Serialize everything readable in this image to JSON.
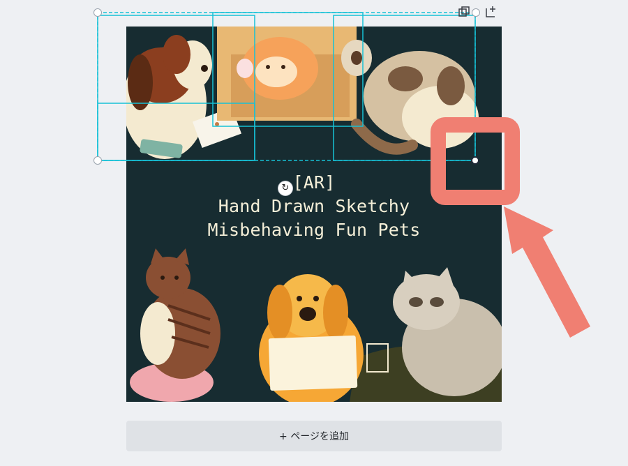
{
  "design": {
    "title_line1": "[AR]",
    "title_line2": "Hand Drawn Sketchy",
    "title_line3": "Misbehaving Fun Pets"
  },
  "toolbar": {
    "duplicate_icon": "duplicate-page-icon",
    "add_icon": "add-page-icon"
  },
  "footer": {
    "add_page_label": "+ ページを追加"
  },
  "colors": {
    "canvas_bg": "#172c31",
    "selection": "#16c1d6",
    "callout": "#f07f72",
    "text": "#f4efd8"
  }
}
